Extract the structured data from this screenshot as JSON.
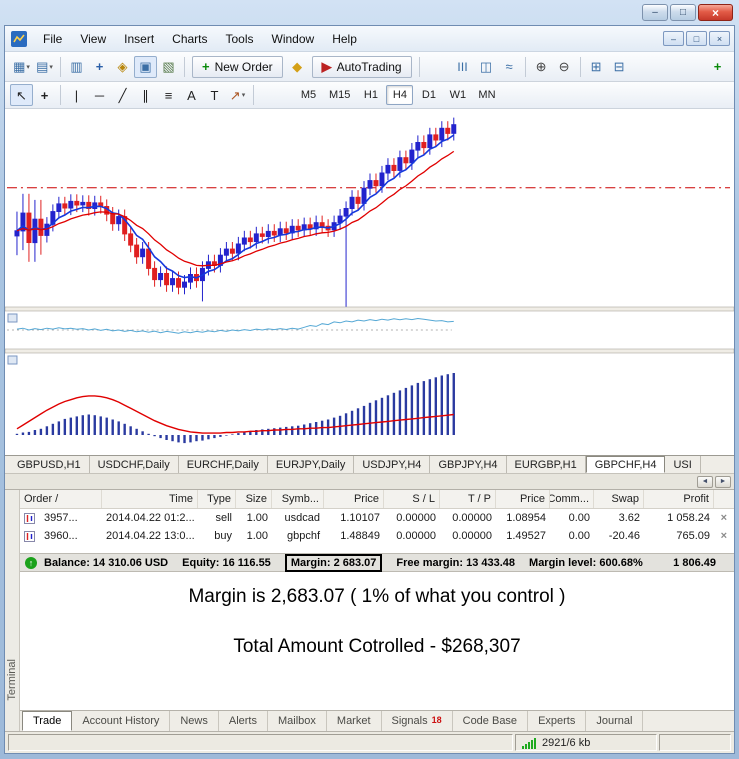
{
  "menu": {
    "items": [
      "File",
      "View",
      "Insert",
      "Charts",
      "Tools",
      "Window",
      "Help"
    ]
  },
  "toolbar_main": {
    "new_order_label": "New Order",
    "autotrading_label": "AutoTrading",
    "icons_file": [
      "new-chart",
      "profiles"
    ],
    "icons_panels": [
      "market-watch",
      "data-window",
      "navigator",
      "terminal",
      "strategy-tester"
    ],
    "icons_mid": [
      "metaeditor"
    ],
    "icons_chart_type": [
      "chart-bars",
      "chart-candlesticks",
      "chart-line"
    ],
    "icons_zoom": [
      "zoom-in",
      "zoom-out"
    ],
    "icons_windows": [
      "cascade-windows",
      "tile-windows"
    ],
    "icons_end": [
      "add-chart"
    ],
    "pressed": [
      "terminal"
    ]
  },
  "toolbar_draw": {
    "icons": [
      "cursor",
      "crosshair",
      "vertical-line",
      "horizontal-line",
      "trendline",
      "equidistant-channel",
      "fibonacci",
      "text-tool",
      "label-tool",
      "arrows-tool"
    ],
    "pressed": [
      "cursor"
    ],
    "timeframes": [
      "M5",
      "M15",
      "H1",
      "H4",
      "D1",
      "W1",
      "MN"
    ],
    "active_timeframe": "H4"
  },
  "chart_tabs": {
    "items": [
      "GBPUSD,H1",
      "USDCHF,Daily",
      "EURCHF,Daily",
      "EURJPY,Daily",
      "USDJPY,H4",
      "GBPJPY,H4",
      "EURGBP,H1",
      "GBPCHF,H4",
      "USI"
    ],
    "active": "GBPCHF,H4"
  },
  "chart_data": {
    "type": "candlestick",
    "symbol": "GBPCHF",
    "timeframe": "H4",
    "price_range": [
      1.4645,
      1.5035
    ],
    "resistance_level": 1.488,
    "candles": {
      "closes": [
        1.4795,
        1.483,
        1.4772,
        1.4818,
        1.4786,
        1.4808,
        1.4833,
        1.4848,
        1.484,
        1.4853,
        1.4846,
        1.4851,
        1.4839,
        1.485,
        1.4843,
        1.4828,
        1.4809,
        1.4823,
        1.4789,
        1.4767,
        1.4744,
        1.4759,
        1.4721,
        1.4699,
        1.4711,
        1.4689,
        1.4701,
        1.4684,
        1.4694,
        1.4709,
        1.4697,
        1.4721,
        1.4734,
        1.4727,
        1.4747,
        1.4759,
        1.4751,
        1.4769,
        1.4781,
        1.4774,
        1.4789,
        1.4784,
        1.4794,
        1.4787,
        1.4799,
        1.4791,
        1.4804,
        1.4797,
        1.4807,
        1.4799,
        1.4811,
        1.4804,
        1.4797,
        1.4811,
        1.4824,
        1.4839,
        1.4861,
        1.4849,
        1.4879,
        1.4894,
        1.4884,
        1.4909,
        1.4924,
        1.4914,
        1.4939,
        1.4929,
        1.4954,
        1.4969,
        1.4959,
        1.4984,
        1.4974,
        1.4997,
        1.4987,
        1.5004
      ],
      "wick_default": 0.0014,
      "wide_wick": 0.0038,
      "wide_range_indices": [
        0,
        1,
        2,
        3,
        4
      ],
      "low_overrides": {
        "31": 1.4656,
        "55": 1.4645
      }
    },
    "indicator1": {
      "type": "line",
      "values": [
        0.05,
        0.1,
        0.0,
        0.08,
        0.02,
        0.1,
        0.05,
        0.12,
        0.06,
        0.1,
        0.04,
        0.08,
        0.0,
        0.06,
        -0.02,
        0.04,
        -0.05,
        0.0,
        -0.08,
        -0.02,
        -0.1,
        -0.05,
        -0.12,
        -0.06,
        -0.15,
        -0.08,
        -0.12,
        -0.18,
        -0.1,
        -0.15,
        -0.08,
        -0.12,
        -0.05,
        -0.1,
        -0.02,
        -0.08,
        0.0,
        -0.05,
        0.02,
        -0.03,
        0.05,
        0.0,
        0.06,
        0.02,
        0.08,
        0.03,
        0.1,
        0.05,
        0.15,
        0.25,
        0.2,
        0.35,
        0.3,
        0.45,
        0.4,
        0.5,
        0.45,
        0.55,
        0.5,
        0.58,
        0.52,
        0.6,
        0.55,
        0.62,
        0.57,
        0.63,
        0.58,
        0.64,
        0.6,
        0.55,
        0.5,
        0.52,
        0.45,
        0.48
      ]
    },
    "macd": {
      "type": "histogram+line",
      "histogram": [
        0.02,
        0.04,
        0.05,
        0.08,
        0.1,
        0.14,
        0.18,
        0.22,
        0.26,
        0.28,
        0.3,
        0.32,
        0.33,
        0.32,
        0.3,
        0.28,
        0.25,
        0.22,
        0.18,
        0.14,
        0.1,
        0.06,
        0.02,
        -0.02,
        -0.05,
        -0.08,
        -0.1,
        -0.12,
        -0.13,
        -0.12,
        -0.1,
        -0.09,
        -0.07,
        -0.05,
        -0.03,
        -0.01,
        0.01,
        0.03,
        0.05,
        0.06,
        0.08,
        0.09,
        0.1,
        0.11,
        0.12,
        0.13,
        0.14,
        0.15,
        0.17,
        0.19,
        0.21,
        0.23,
        0.25,
        0.28,
        0.31,
        0.35,
        0.39,
        0.43,
        0.47,
        0.52,
        0.56,
        0.6,
        0.64,
        0.68,
        0.72,
        0.76,
        0.8,
        0.84,
        0.87,
        0.9,
        0.93,
        0.96,
        0.98,
        1.0
      ],
      "signal": [
        0.1,
        0.16,
        0.22,
        0.28,
        0.34,
        0.4,
        0.45,
        0.5,
        0.54,
        0.57,
        0.6,
        0.62,
        0.63,
        0.63,
        0.62,
        0.6,
        0.57,
        0.53,
        0.48,
        0.43,
        0.38,
        0.33,
        0.28,
        0.23,
        0.19,
        0.15,
        0.12,
        0.09,
        0.07,
        0.05,
        0.04,
        0.03,
        0.03,
        0.03,
        0.03,
        0.04,
        0.04,
        0.05,
        0.05,
        0.06,
        0.06,
        0.07,
        0.07,
        0.08,
        0.08,
        0.09,
        0.09,
        0.1,
        0.1,
        0.11,
        0.11,
        0.12,
        0.12,
        0.13,
        0.14,
        0.15,
        0.16,
        0.17,
        0.18,
        0.19,
        0.2,
        0.21,
        0.22,
        0.23,
        0.24,
        0.25,
        0.26,
        0.27,
        0.28,
        0.29,
        0.3,
        0.31,
        0.32,
        0.33
      ]
    },
    "colors": {
      "bull": "#2323cd",
      "bear": "#e02020",
      "ma_fast": "#1538dd",
      "ma_slow": "#e00000",
      "indicator_line": "#55a8d5",
      "histogram": "#2a3aa0",
      "signal_line": "#e00000",
      "resistance": "#cc0000"
    }
  },
  "terminal": {
    "columns": [
      "Order /",
      "Time",
      "Type",
      "Size",
      "Symb...",
      "Price",
      "S / L",
      "T / P",
      "Price",
      "Comm...",
      "Swap",
      "Profit"
    ],
    "orders": [
      {
        "order": "3957...",
        "time": "2014.04.22 01:2...",
        "type": "sell",
        "size": "1.00",
        "symbol": "usdcad",
        "price": "1.10107",
        "sl": "0.00000",
        "tp": "0.00000",
        "price2": "1.08954",
        "comm": "0.00",
        "swap": "3.62",
        "profit": "1 058.24"
      },
      {
        "order": "3960...",
        "time": "2014.04.22 13:0...",
        "type": "buy",
        "size": "1.00",
        "symbol": "gbpchf",
        "price": "1.48849",
        "sl": "0.00000",
        "tp": "0.00000",
        "price2": "1.49527",
        "comm": "0.00",
        "swap": "-20.46",
        "profit": "765.09"
      }
    ],
    "balance_items": [
      {
        "label": "Balance:",
        "value": "14 310.06 USD"
      },
      {
        "label": "Equity:",
        "value": "16 116.55"
      },
      {
        "label": "Margin:",
        "value": "2 683.07",
        "boxed": true
      },
      {
        "label": "Free margin:",
        "value": "13 433.48"
      },
      {
        "label": "Margin level:",
        "value": "600.68%"
      }
    ],
    "floating_profit": "1 806.49",
    "tabs": [
      {
        "label": "Trade",
        "active": true
      },
      {
        "label": "Account History"
      },
      {
        "label": "News"
      },
      {
        "label": "Alerts"
      },
      {
        "label": "Mailbox"
      },
      {
        "label": "Market"
      },
      {
        "label": "Signals",
        "badge": "18"
      },
      {
        "label": "Code Base"
      },
      {
        "label": "Experts"
      },
      {
        "label": "Journal"
      }
    ],
    "side_label": "Terminal"
  },
  "annotations": {
    "line1": "Margin is 2,683.07   ( 1% of what you control )",
    "line2": "Total Amount Cotrolled - $268,307"
  },
  "status_bar": {
    "traffic": "2921/6 kb"
  }
}
